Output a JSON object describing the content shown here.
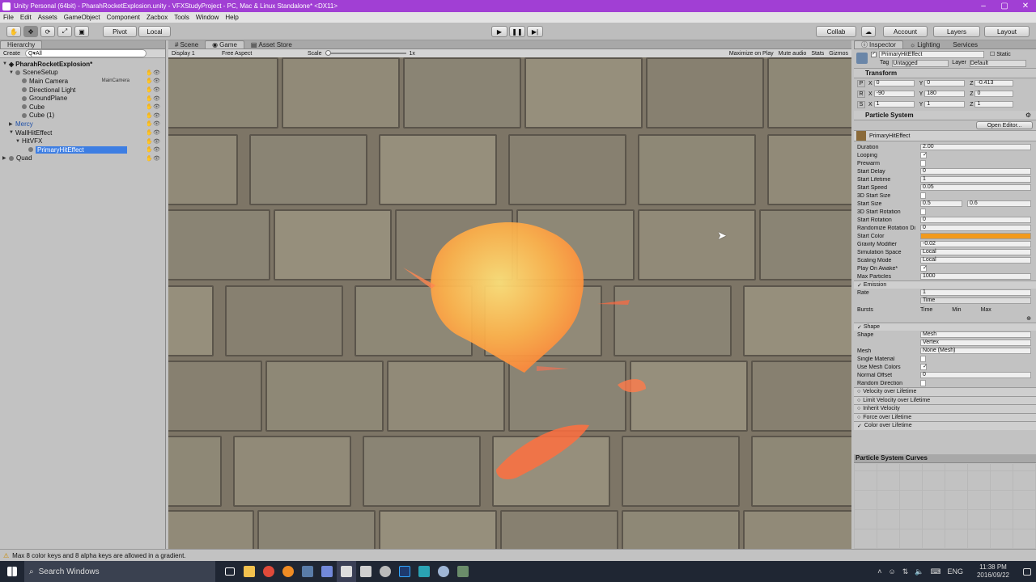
{
  "window": {
    "title": "Unity Personal (64bit) - PharahRocketExplosion.unity - VFXStudyProject - PC, Mac & Linux Standalone* <DX11>"
  },
  "menu": [
    "File",
    "Edit",
    "Assets",
    "GameObject",
    "Component",
    "Zacbox",
    "Tools",
    "Window",
    "Help"
  ],
  "toolbar": {
    "pivot": "Pivot",
    "local": "Local",
    "collab": "Collab",
    "account": "Account",
    "layers": "Layers",
    "layout": "Layout"
  },
  "hierarchy": {
    "tab": "Hierarchy",
    "create": "Create",
    "search": "Q▾All",
    "scene": "PharahRocketExplosion*",
    "items": [
      {
        "label": "SceneSetup",
        "tag": ""
      },
      {
        "label": "Main Camera",
        "tag": "MainCamera"
      },
      {
        "label": "Directional Light",
        "tag": ""
      },
      {
        "label": "GroundPlane",
        "tag": ""
      },
      {
        "label": "Cube",
        "tag": ""
      },
      {
        "label": "Cube (1)",
        "tag": ""
      },
      {
        "label": "Mercy",
        "tag": ""
      },
      {
        "label": "WallHitEffect",
        "tag": ""
      },
      {
        "label": "HitVFX",
        "tag": ""
      },
      {
        "label": "PrimaryHitEffect",
        "tag": ""
      },
      {
        "label": "Quad",
        "tag": ""
      }
    ]
  },
  "sceneview": {
    "tabs": [
      "Scene",
      "Game",
      "Asset Store"
    ],
    "display": "Display 1",
    "aspect": "Free Aspect",
    "scale_label": "Scale",
    "scale_value": "1x",
    "options": [
      "Maximize on Play",
      "Mute audio",
      "Stats",
      "Gizmos"
    ]
  },
  "inspector": {
    "tabs": [
      "Inspector",
      "Lighting",
      "Services"
    ],
    "object_name": "PrimaryHitEffect",
    "static": "Static",
    "tag_label": "Tag",
    "tag_value": "Untagged",
    "layer_label": "Layer",
    "layer_value": "Default",
    "transform": {
      "title": "Transform",
      "position": {
        "x": "0",
        "y": "0",
        "z": "-0.413"
      },
      "rotation": {
        "x": "-90",
        "y": "180",
        "z": "0"
      },
      "scale": {
        "x": "1",
        "y": "1",
        "z": "1"
      }
    },
    "ps_title": "Particle System",
    "open_editor": "Open Editor...",
    "ps_name": "PrimaryHitEffect",
    "props": [
      {
        "label": "Duration",
        "value": "2.00"
      },
      {
        "label": "Looping",
        "value": "✓"
      },
      {
        "label": "Prewarm",
        "value": ""
      },
      {
        "label": "Start Delay",
        "value": "0"
      },
      {
        "label": "Start Lifetime",
        "value": "1"
      },
      {
        "label": "Start Speed",
        "value": "0.05"
      },
      {
        "label": "3D Start Size",
        "value": ""
      },
      {
        "label": "Start Size",
        "value": "0.5",
        "value2": "0.6"
      },
      {
        "label": "3D Start Rotation",
        "value": ""
      },
      {
        "label": "Start Rotation",
        "value": "0"
      },
      {
        "label": "Randomize Rotation Di",
        "value": "0"
      },
      {
        "label": "Start Color",
        "value": ""
      },
      {
        "label": "Gravity Modifier",
        "value": "-0.02"
      },
      {
        "label": "Simulation Space",
        "value": "Local"
      },
      {
        "label": "Scaling Mode",
        "value": "Local"
      },
      {
        "label": "Play On Awake*",
        "value": "✓"
      },
      {
        "label": "Max Particles",
        "value": "1000"
      }
    ],
    "emission": {
      "title": "Emission",
      "rate_label": "Rate",
      "rate_value": "1",
      "rate_mode": "Time",
      "bursts_label": "Bursts",
      "cols": [
        "Time",
        "Min",
        "Max"
      ]
    },
    "shape": {
      "title": "Shape",
      "props": [
        {
          "label": "Shape",
          "value": "Mesh"
        },
        {
          "label": "",
          "value": "Vertex"
        },
        {
          "label": "Mesh",
          "value": "None (Mesh)"
        },
        {
          "label": "Single Material",
          "value": ""
        },
        {
          "label": "Use Mesh Colors",
          "value": "✓"
        },
        {
          "label": "Normal Offset",
          "value": "0"
        },
        {
          "label": "Random Direction",
          "value": ""
        }
      ]
    },
    "modules": [
      "Velocity over Lifetime",
      "Limit Velocity over Lifetime",
      "Inherit Velocity",
      "Force over Lifetime",
      "Color over Lifetime"
    ]
  },
  "curves": {
    "title": "Particle System Curves"
  },
  "status": "Max 8 color keys and 8 alpha keys are allowed in a gradient.",
  "taskbar": {
    "search": "Search Windows",
    "lang": "ENG",
    "time": "11:38 PM",
    "date": "2016/09/22"
  },
  "colors": {
    "titlebar": "#a13fd4",
    "selection": "#3d7ee3",
    "start_color": "#f19a1d",
    "taskbar": "#1f2633"
  }
}
